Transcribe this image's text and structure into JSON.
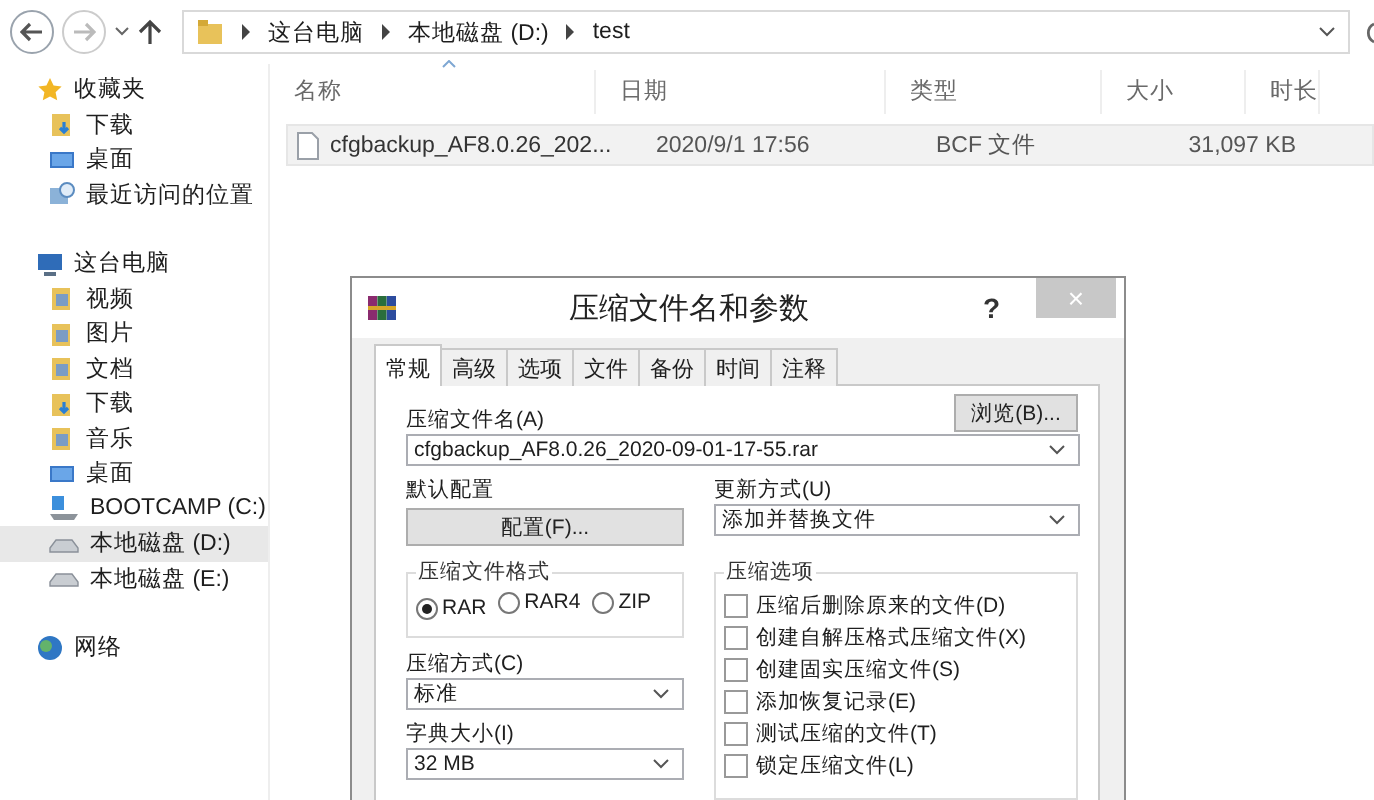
{
  "explorer": {
    "path": [
      "这台电脑",
      "本地磁盘 (D:)",
      "test"
    ],
    "columns": [
      "名称",
      "日期",
      "类型",
      "大小",
      "时长"
    ],
    "files": [
      {
        "name": "cfgbackup_AF8.0.26_202...",
        "date": "2020/9/1 17:56",
        "type": "BCF 文件",
        "size": "31,097 KB"
      }
    ],
    "sidebar": [
      {
        "label": "收藏夹",
        "kind": "star",
        "selected": false,
        "children": [
          {
            "label": "下载",
            "kind": "download",
            "selected": false
          },
          {
            "label": "桌面",
            "kind": "desktop",
            "selected": false
          },
          {
            "label": "最近访问的位置",
            "kind": "recent",
            "selected": false
          }
        ]
      },
      {
        "label": "这台电脑",
        "kind": "computer",
        "selected": false,
        "children": [
          {
            "label": "视频",
            "kind": "folder",
            "selected": false
          },
          {
            "label": "图片",
            "kind": "folder",
            "selected": false
          },
          {
            "label": "文档",
            "kind": "folder",
            "selected": false
          },
          {
            "label": "下载",
            "kind": "download",
            "selected": false
          },
          {
            "label": "音乐",
            "kind": "folder",
            "selected": false
          },
          {
            "label": "桌面",
            "kind": "desktop",
            "selected": false
          },
          {
            "label": "BOOTCAMP (C:)",
            "kind": "windrive",
            "selected": false
          },
          {
            "label": "本地磁盘 (D:)",
            "kind": "drive",
            "selected": true
          },
          {
            "label": "本地磁盘 (E:)",
            "kind": "drive",
            "selected": false
          }
        ]
      },
      {
        "label": "网络",
        "kind": "network",
        "selected": false
      }
    ]
  },
  "dialog": {
    "title": "压缩文件名和参数",
    "help": "?",
    "close": "×",
    "tabs": [
      {
        "label": "常规",
        "selected": true
      },
      {
        "label": "高级",
        "selected": false
      },
      {
        "label": "选项",
        "selected": false
      },
      {
        "label": "文件",
        "selected": false
      },
      {
        "label": "备份",
        "selected": false
      },
      {
        "label": "时间",
        "selected": false
      },
      {
        "label": "注释",
        "selected": false
      }
    ],
    "archive_name_label": "压缩文件名(A)",
    "browse_button": "浏览(B)...",
    "archive_name": "cfgbackup_AF8.0.26_2020-09-01-17-55.rar",
    "default_profile_label": "默认配置",
    "profile_button": "配置(F)...",
    "update_mode_label": "更新方式(U)",
    "update_mode": "添加并替换文件",
    "format_group": "压缩文件格式",
    "formats": [
      {
        "label": "RAR",
        "selected": true
      },
      {
        "label": "RAR4",
        "selected": false
      },
      {
        "label": "ZIP",
        "selected": false
      }
    ],
    "method_label": "压缩方式(C)",
    "method": "标准",
    "dictionary_label": "字典大小(I)",
    "dictionary": "32 MB",
    "options_group": "压缩选项",
    "options": [
      {
        "label": "压缩后删除原来的文件(D)",
        "checked": false
      },
      {
        "label": "创建自解压格式压缩文件(X)",
        "checked": false
      },
      {
        "label": "创建固实压缩文件(S)",
        "checked": false
      },
      {
        "label": "添加恢复记录(E)",
        "checked": false
      },
      {
        "label": "测试压缩的文件(T)",
        "checked": false
      },
      {
        "label": "锁定压缩文件(L)",
        "checked": false
      }
    ]
  }
}
